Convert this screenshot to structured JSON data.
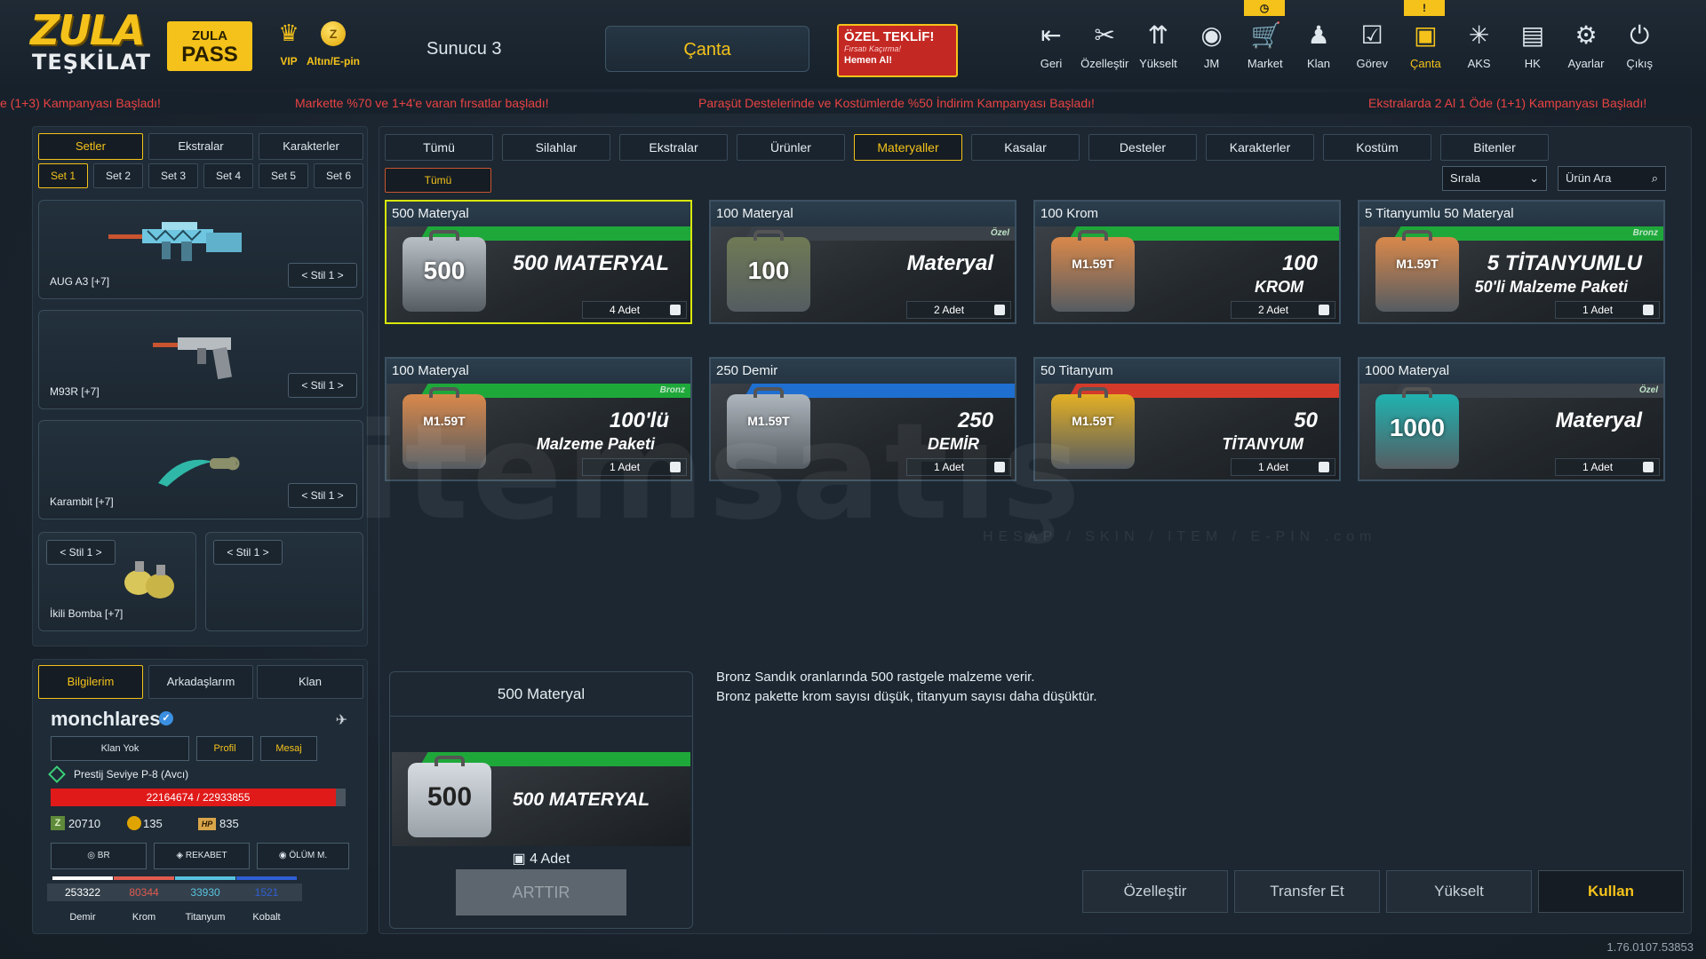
{
  "topbar": {
    "logo_line1": "ZULA",
    "logo_line2": "TEŞKİLAT",
    "pass_line1": "ZULA",
    "pass_line2": "PASS",
    "vip_label": "VIP",
    "altin_label": "Altın/E-pin",
    "server": "Sunucu 3",
    "canta_title": "Çanta",
    "offer": {
      "title": "ÖZEL TEKLİF!",
      "sub": "Fırsatı Kaçırma!",
      "cta": "Hemen Al!"
    },
    "nav": [
      {
        "label": "Geri",
        "icon": "back-icon"
      },
      {
        "label": "Özelleştir",
        "icon": "tools-icon"
      },
      {
        "label": "Yükselt",
        "icon": "upgrade-icon"
      },
      {
        "label": "JM",
        "icon": "coins-icon"
      },
      {
        "label": "Market",
        "icon": "cart-icon"
      },
      {
        "label": "Klan",
        "icon": "clan-icon"
      },
      {
        "label": "Görev",
        "icon": "task-icon"
      },
      {
        "label": "Çanta",
        "icon": "bag-icon"
      },
      {
        "label": "AKS",
        "icon": "aks-icon"
      },
      {
        "label": "HK",
        "icon": "wallet-icon"
      },
      {
        "label": "Ayarlar",
        "icon": "gear-icon"
      },
      {
        "label": "Çıkış",
        "icon": "power-icon"
      }
    ],
    "notif_market": "◷",
    "notif_canta": "!"
  },
  "ticker": [
    "e (1+3) Kampanyası Başladı!",
    "Markette %70 ve 1+4'e varan fırsatlar başladı!",
    "Paraşüt Destelerinde ve Kostümlerde %50 İndirim Kampanyası Başladı!",
    "Ekstralarda 2 Al 1 Öde (1+1) Kampanyası Başladı!"
  ],
  "left": {
    "tabs": [
      "Setler",
      "Ekstralar",
      "Karakterler"
    ],
    "sets": [
      "Set 1",
      "Set 2",
      "Set 3",
      "Set 4",
      "Set 5",
      "Set 6"
    ],
    "slots": [
      {
        "name": "AUG A3 [+7]",
        "style": "Stil 1"
      },
      {
        "name": "M93R [+7]",
        "style": "Stil 1"
      },
      {
        "name": "Karambit [+7]",
        "style": "Stil 1"
      },
      {
        "name": "İkili Bomba [+7]",
        "style": "Stil 1"
      },
      {
        "name": "",
        "style": "Stil 1"
      }
    ]
  },
  "profile": {
    "tabs": [
      "Bilgilerim",
      "Arkadaşlarım",
      "Klan"
    ],
    "username": "monchlares",
    "buttons": [
      "Klan Yok",
      "Profil",
      "Mesaj"
    ],
    "rank": "Prestij Seviye P-8 (Avcı)",
    "xp_text": "22164674 / 22933855",
    "xp_fraction": 0.966,
    "zp": "20710",
    "gold": "135",
    "hp": "835",
    "modes": [
      "BR",
      "REKABET",
      "ÖLÜM M."
    ],
    "materials": [
      {
        "label": "Demir",
        "value": "253322",
        "color": "#ffffff"
      },
      {
        "label": "Krom",
        "value": "80344",
        "color": "#e25b4f"
      },
      {
        "label": "Titanyum",
        "value": "33930",
        "color": "#58c3e0"
      },
      {
        "label": "Kobalt",
        "value": "1521",
        "color": "#2f5fd6"
      }
    ]
  },
  "main": {
    "categories": [
      "Tümü",
      "Silahlar",
      "Ekstralar",
      "Ürünler",
      "Materyaller",
      "Kasalar",
      "Desteler",
      "Karakterler",
      "Kostüm",
      "Bitenler"
    ],
    "active_category": "Materyaller",
    "subfilter": "Tümü",
    "sort_label": "Sırala",
    "search_placeholder": "Ürün Ara",
    "cards": [
      {
        "title": "500 Materyal",
        "case_num": "500",
        "big": "500 MATERYAL",
        "sub": "",
        "tier": "",
        "qty": "4 Adet",
        "case_color": "#b9c0c6",
        "stripe": "#1fa83a"
      },
      {
        "title": "100 Materyal",
        "case_num": "100",
        "big": "Materyal",
        "sub": "",
        "tier": "Özel",
        "qty": "2 Adet",
        "case_color": "#6f7a55",
        "stripe": "#3b4148"
      },
      {
        "title": "100 Krom",
        "case_num": "M1.59T",
        "big": "100",
        "sub": "KROM",
        "tier": "",
        "qty": "2 Adet",
        "case_color": "#d9884a",
        "stripe": "#1fa83a"
      },
      {
        "title": "5 Titanyumlu 50 Materyal",
        "case_num": "M1.59T",
        "big": "5 TİTANYUMLU",
        "sub": "50'li Malzeme Paketi",
        "tier": "Bronz",
        "qty": "1 Adet",
        "case_color": "#d9884a",
        "stripe": "#1fa83a"
      },
      {
        "title": "100 Materyal",
        "case_num": "M1.59T",
        "big": "100'lü",
        "sub": "Malzeme Paketi",
        "tier": "Bronz",
        "qty": "1 Adet",
        "case_color": "#d9884a",
        "stripe": "#1fa83a"
      },
      {
        "title": "250 Demir",
        "case_num": "M1.59T",
        "big": "250",
        "sub": "DEMİR",
        "tier": "",
        "qty": "1 Adet",
        "case_color": "#aeb6bd",
        "stripe": "#1f6fd0"
      },
      {
        "title": "50 Titanyum",
        "case_num": "M1.59T",
        "big": "50",
        "sub": "TİTANYUM",
        "tier": "",
        "qty": "1 Adet",
        "case_color": "#e3b024",
        "stripe": "#d43a2a"
      },
      {
        "title": "1000 Materyal",
        "case_num": "1000",
        "big": "Materyal",
        "sub": "",
        "tier": "Özel",
        "qty": "1 Adet",
        "case_color": "#1fb3b0",
        "stripe": "#3b4148"
      }
    ]
  },
  "detail": {
    "title": "500 Materyal",
    "art_text": "500 MATERYAL",
    "case_num": "500",
    "qty": "4 Adet",
    "arttir": "ARTTIR",
    "desc_line1": "Bronz Sandık oranlarında 500 rastgele malzeme verir.",
    "desc_line2": "Bronz pakette krom sayısı düşük, titanyum sayısı daha düşüktür.",
    "actions": [
      "Özelleştir",
      "Transfer Et",
      "Yükselt",
      "Kullan"
    ]
  },
  "version": "1.76.0107.53853",
  "watermark": "itemsatış",
  "watermark_sub": "HESAP / SKIN / ITEM / E-PIN .com"
}
